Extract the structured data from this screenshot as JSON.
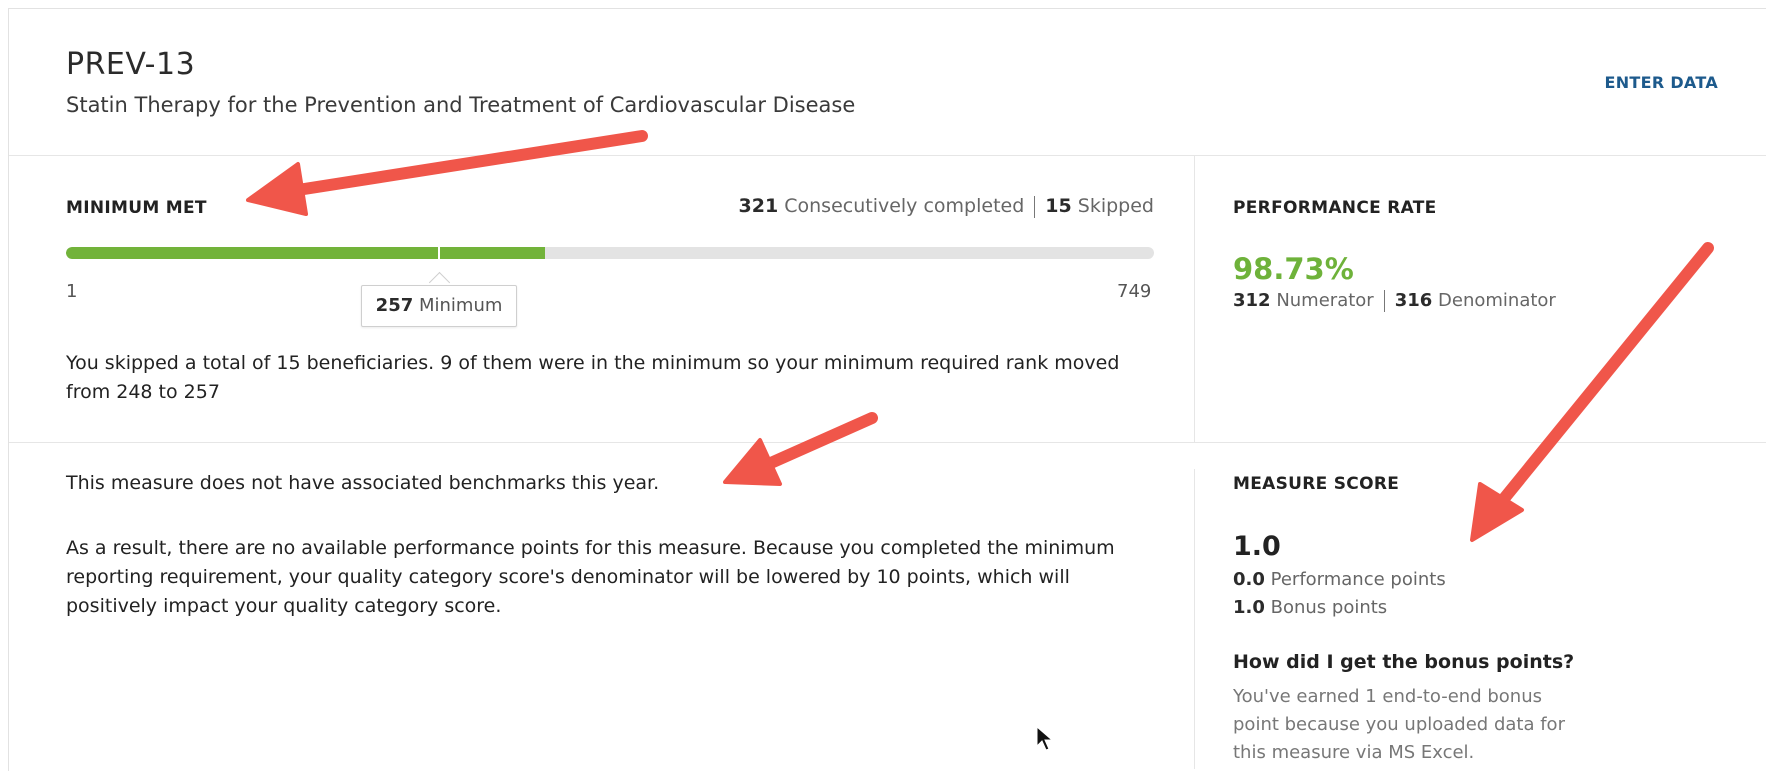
{
  "header": {
    "measure_id": "PREV-13",
    "measure_title": "Statin Therapy for the Prevention and Treatment of Cardiovascular Disease",
    "enter_data_label": "ENTER DATA"
  },
  "minimum": {
    "status_label": "MINIMUM MET",
    "consecutive_count": "321",
    "consecutive_label": "Consecutively completed",
    "skipped_count": "15",
    "skipped_label": "Skipped",
    "range_start": "1",
    "range_end": "749",
    "minimum_value": "257",
    "minimum_label": "Minimum",
    "progress_fraction": 0.44,
    "minimum_fraction": 0.343,
    "explanation": "You skipped a total of 15 beneficiaries. 9 of them were in the minimum so your minimum required rank moved from 248 to 257"
  },
  "performance": {
    "label": "PERFORMANCE RATE",
    "rate": "98.73%",
    "numerator_value": "312",
    "numerator_label": "Numerator",
    "denominator_value": "316",
    "denominator_label": "Denominator"
  },
  "benchmarks": {
    "notice": "This measure does not have associated benchmarks this year.",
    "explanation": "As a result, there are no available performance points for this measure. Because you completed the minimum reporting requirement, your quality category score's denominator will be lowered by 10 points, which will positively impact your quality category score."
  },
  "score": {
    "label": "MEASURE SCORE",
    "value": "1.0",
    "performance_points_value": "0.0",
    "performance_points_label": "Performance points",
    "bonus_points_value": "1.0",
    "bonus_points_label": "Bonus points",
    "bonus_question": "How did I get the bonus points?",
    "bonus_explanation": "You've earned 1 end-to-end bonus point because you uploaded data for this measure via MS Excel."
  },
  "colors": {
    "progress_green": "#72b33a",
    "rate_green": "#6eb23a",
    "link_blue": "#1d5a8c",
    "annotation_arrow": "#f0564a"
  }
}
